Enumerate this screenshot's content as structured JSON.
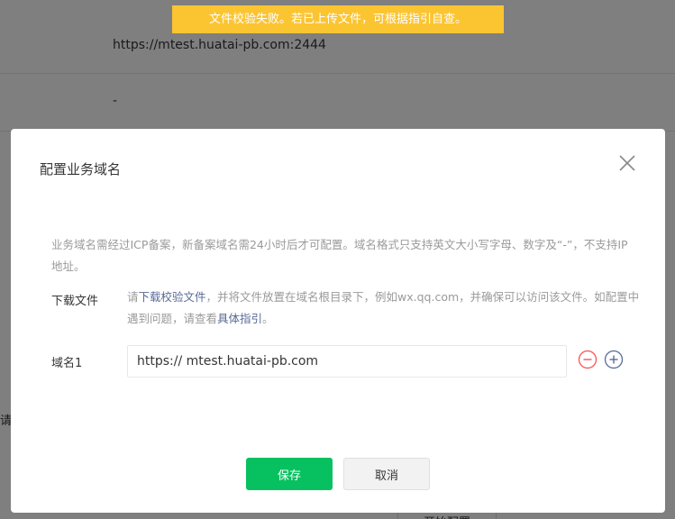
{
  "background": {
    "rows": [
      {
        "value": "https://mtest.huatai-pb.com:2444"
      },
      {
        "value": "-"
      }
    ],
    "left_fragment": "请w",
    "start_button_label": "开始配置"
  },
  "toast": {
    "message": "文件校验失败。若已上传文件，可根据指引自查。"
  },
  "modal": {
    "title": "配置业务域名",
    "notice": "业务域名需经过ICP备案，新备案域名需24小时后才可配置。域名格式只支持英文大小写字母、数字及“-”，不支持IP地址。",
    "download": {
      "label": "下载文件",
      "prefix": "请",
      "link_text": "下载校验文件",
      "middle": "，并将文件放置在域名根目录下，例如wx.qq.com，并确保可以访问该文件。如配置中遇到问题，请查看",
      "guide_link": "具体指引",
      "suffix": "。"
    },
    "domain": {
      "label": "域名1",
      "value": "https:// mtest.huatai-pb.com"
    },
    "buttons": {
      "save": "保存",
      "cancel": "取消"
    }
  },
  "colors": {
    "primary": "#07c160",
    "toast": "#fbc431",
    "link": "#576b95",
    "danger": "#fa5151"
  }
}
